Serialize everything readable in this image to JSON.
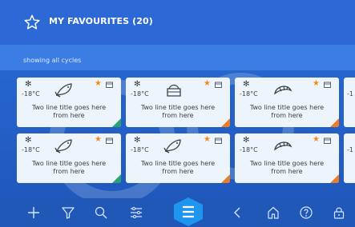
{
  "header": {
    "title": "MY FAVOURITES (20)",
    "icon": "star-outline-icon"
  },
  "filter": {
    "text": "showing all cycles"
  },
  "cards": [
    {
      "temp": "-18°C",
      "title_line1": "Two line title goes here",
      "title_line2": "from here",
      "food_icon": "fish-icon",
      "corner": "green"
    },
    {
      "temp": "-18°C",
      "title_line1": "Two line title goes here",
      "title_line2": "from here",
      "food_icon": "cake-icon",
      "corner": "orange"
    },
    {
      "temp": "-18°C",
      "title_line1": "Two line title goes here",
      "title_line2": "from here",
      "food_icon": "croissant-icon",
      "corner": "orange"
    },
    {
      "temp": "-18°C",
      "title_line1": "Two line title goes here",
      "title_line2": "from here",
      "food_icon": "fish-icon",
      "corner": "green"
    },
    {
      "temp": "-18°C",
      "title_line1": "Two line title goes here",
      "title_line2": "from here",
      "food_icon": "fish-icon",
      "corner": "orange"
    },
    {
      "temp": "-18°C",
      "title_line1": "Two line title goes here",
      "title_line2": "from here",
      "food_icon": "croissant-icon",
      "corner": "orange"
    }
  ],
  "partial_cards": [
    {
      "temp": "-1"
    },
    {
      "temp": "-1"
    }
  ],
  "bottom_nav": [
    "add-icon",
    "filter-icon",
    "search-icon",
    "settings-sliders-icon",
    "menu-icon",
    "back-icon",
    "home-icon",
    "help-icon",
    "lock-icon"
  ],
  "colors": {
    "header": "#2c69d6",
    "subbar": "#3b7de3",
    "bottom": "#2058b8",
    "accent_orange": "#ee7d22",
    "accent_green": "#26a36e"
  }
}
